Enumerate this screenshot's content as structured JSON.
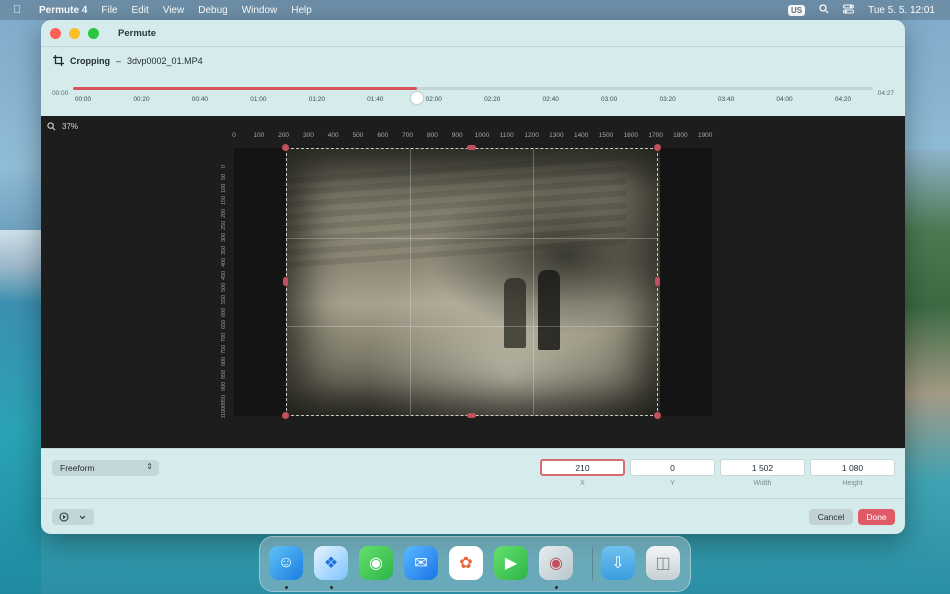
{
  "menubar": {
    "app_name": "Permute 4",
    "items": [
      "File",
      "Edit",
      "View",
      "Debug",
      "Window",
      "Help"
    ],
    "keyboard_layout": "US",
    "datetime": "Tue 5. 5.  12:01"
  },
  "window": {
    "title": "Permute",
    "mode_label": "Cropping",
    "separator": "–",
    "file_name": "3dvp0002_01.MP4"
  },
  "timeline": {
    "start": "00:00",
    "end": "04:27",
    "progress_fraction": 0.43,
    "ticks": [
      "00:00",
      "00:20",
      "00:40",
      "01:00",
      "01:20",
      "01:40",
      "02:00",
      "02:20",
      "02:40",
      "03:00",
      "03:20",
      "03:40",
      "04:00",
      "04:20"
    ]
  },
  "canvas": {
    "zoom": "37%",
    "ruler_h": [
      "0",
      "100",
      "200",
      "300",
      "400",
      "500",
      "600",
      "700",
      "800",
      "900",
      "1000",
      "1100",
      "1200",
      "1300",
      "1400",
      "1500",
      "1600",
      "1700",
      "1800",
      "1900"
    ],
    "ruler_v": [
      "0",
      "50",
      "100",
      "150",
      "200",
      "250",
      "300",
      "350",
      "400",
      "450",
      "500",
      "550",
      "600",
      "650",
      "700",
      "750",
      "800",
      "850",
      "900",
      "950",
      "1000",
      "1050"
    ]
  },
  "crop": {
    "aspect": "Freeform",
    "fields": [
      {
        "label": "X",
        "value": "210"
      },
      {
        "label": "Y",
        "value": "0"
      },
      {
        "label": "Width",
        "value": "1 502"
      },
      {
        "label": "Height",
        "value": "1 080"
      }
    ]
  },
  "footer": {
    "cancel_label": "Cancel",
    "done_label": "Done"
  },
  "colors": {
    "accent": "#df5a66",
    "window_bg": "#d6ebec",
    "canvas_bg": "#1d1d1d"
  },
  "dock": {
    "apps": [
      "finder-icon",
      "safari-icon",
      "messages-icon",
      "mail-icon",
      "photos-icon",
      "facetime-icon",
      "permute-icon",
      "downloads-folder-icon",
      "trash-icon"
    ]
  }
}
